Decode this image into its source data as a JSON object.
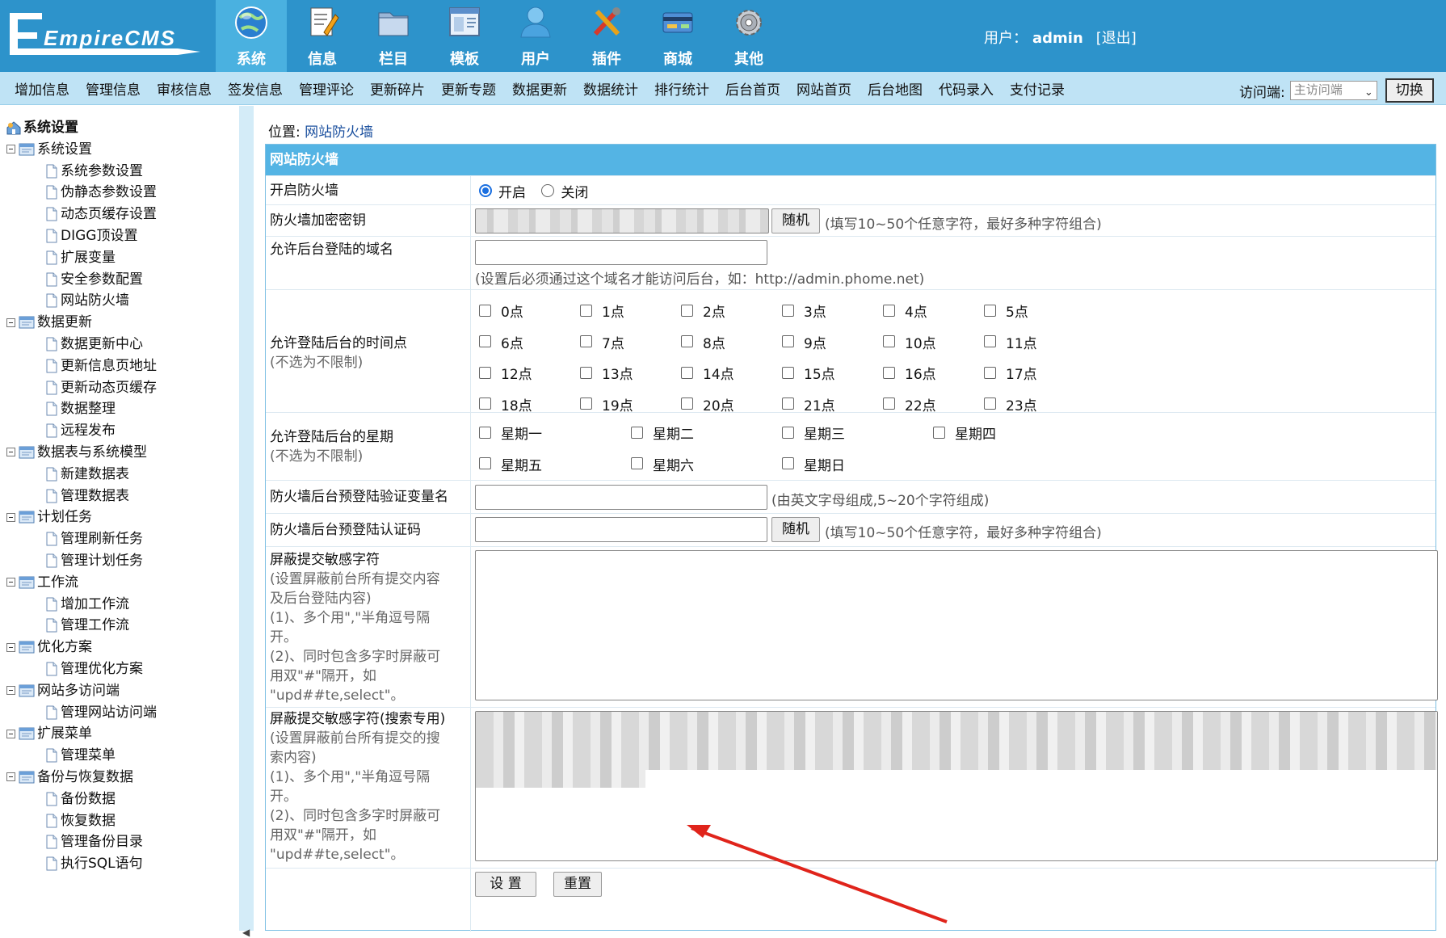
{
  "app": {
    "logo_text": "EmpireCMS"
  },
  "nav": [
    {
      "label": "系统",
      "icon": "globe-icon",
      "active": true
    },
    {
      "label": "信息",
      "icon": "document-edit-icon",
      "active": false
    },
    {
      "label": "栏目",
      "icon": "folder-icon",
      "active": false
    },
    {
      "label": "模板",
      "icon": "window-template-icon",
      "active": false
    },
    {
      "label": "用户",
      "icon": "user-icon",
      "active": false
    },
    {
      "label": "插件",
      "icon": "tools-icon",
      "active": false
    },
    {
      "label": "商城",
      "icon": "card-shop-icon",
      "active": false
    },
    {
      "label": "其他",
      "icon": "gear-icon",
      "active": false
    }
  ],
  "user": {
    "prefix": "用户：",
    "name": "admin",
    "logout": "[退出]"
  },
  "submenu": [
    "增加信息",
    "管理信息",
    "审核信息",
    "签发信息",
    "管理评论",
    "更新碎片",
    "更新专题",
    "数据更新",
    "数据统计",
    "排行统计",
    "后台首页",
    "网站首页",
    "后台地图",
    "代码录入",
    "支付记录"
  ],
  "access": {
    "label": "访问端:",
    "selected": "主访问端",
    "switch": "切换"
  },
  "sidebar": {
    "root": "系统设置",
    "groups": [
      {
        "label": "系统设置",
        "items": [
          "系统参数设置",
          "伪静态参数设置",
          "动态页缓存设置",
          "DIGG顶设置",
          "扩展变量",
          "安全参数配置",
          "网站防火墙"
        ]
      },
      {
        "label": "数据更新",
        "items": [
          "数据更新中心",
          "更新信息页地址",
          "更新动态页缓存",
          "数据整理",
          "远程发布"
        ]
      },
      {
        "label": "数据表与系统模型",
        "items": [
          "新建数据表",
          "管理数据表"
        ]
      },
      {
        "label": "计划任务",
        "items": [
          "管理刷新任务",
          "管理计划任务"
        ]
      },
      {
        "label": "工作流",
        "items": [
          "增加工作流",
          "管理工作流"
        ]
      },
      {
        "label": "优化方案",
        "items": [
          "管理优化方案"
        ]
      },
      {
        "label": "网站多访问端",
        "items": [
          "管理网站访问端"
        ]
      },
      {
        "label": "扩展菜单",
        "items": [
          "管理菜单"
        ]
      },
      {
        "label": "备份与恢复数据",
        "items": [
          "备份数据",
          "恢复数据",
          "管理备份目录",
          "执行SQL语句"
        ]
      }
    ]
  },
  "breadcrumb": {
    "prefix": "位置:",
    "link": "网站防火墙"
  },
  "form": {
    "title": "网站防火墙",
    "enable": {
      "label": "开启防火墙",
      "on": "开启",
      "off": "关闭",
      "selected": "开启"
    },
    "key": {
      "label": "防火墙加密密钥",
      "button": "随机",
      "hint": "(填写10~50个任意字符，最好多种字符组合)"
    },
    "domain": {
      "label": "允许后台登陆的域名",
      "value": "",
      "hint": "(设置后必须通过这个域名才能访问后台，如：http://admin.phome.net)"
    },
    "hours": {
      "label": "允许登陆后台的时间点",
      "note": "(不选为不限制)",
      "options": [
        "0点",
        "1点",
        "2点",
        "3点",
        "4点",
        "5点",
        "6点",
        "7点",
        "8点",
        "9点",
        "10点",
        "11点",
        "12点",
        "13点",
        "14点",
        "15点",
        "16点",
        "17点",
        "18点",
        "19点",
        "20点",
        "21点",
        "22点",
        "23点"
      ]
    },
    "weekdays": {
      "label": "允许登陆后台的星期",
      "note": "(不选为不限制)",
      "options": [
        "星期一",
        "星期二",
        "星期三",
        "星期四",
        "星期五",
        "星期六",
        "星期日"
      ]
    },
    "varname": {
      "label": "防火墙后台预登陆验证变量名",
      "value": "",
      "hint": "(由英文字母组成,5~20个字符组成)"
    },
    "precode": {
      "label": "防火墙后台预登陆认证码",
      "value": "",
      "button": "随机",
      "hint": "(填写10~50个任意字符，最好多种字符组合)"
    },
    "filter": {
      "label": "屏蔽提交敏感字符",
      "notes": [
        "(设置屏蔽前台所有提交内容",
        "及后台登陆内容)",
        "(1)、多个用\",\"半角逗号隔",
        "开。",
        "(2)、同时包含多字时屏蔽可",
        "用双\"#\"隔开，如",
        "\"upd##te,select\"。"
      ]
    },
    "filter_search": {
      "label": "屏蔽提交敏感字符(搜索专用)",
      "notes": [
        "(设置屏蔽前台所有提交的搜",
        "索内容)",
        "(1)、多个用\",\"半角逗号隔",
        "开。",
        "(2)、同时包含多字时屏蔽可",
        "用双\"#\"隔开，如",
        "\"upd##te,select\"。"
      ]
    },
    "submit": "设 置",
    "reset": "重置"
  },
  "colors": {
    "topbar": "#2d93cb",
    "active_tab": "#4ab1e0",
    "subbar": "#bfe3f5",
    "panel_header": "#54b4e4",
    "annotation_arrow": "#e0241b"
  }
}
